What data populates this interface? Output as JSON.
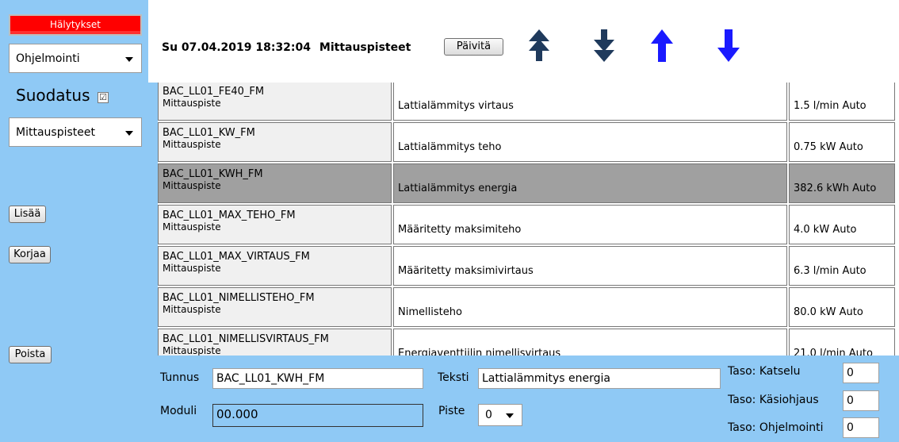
{
  "sidebar": {
    "alarms_label": "Hälytykset",
    "program_select": "Ohjelmointi",
    "filter_label": "Suodatus",
    "filter_checked": "☑",
    "category_select": "Mittauspisteet",
    "add_label": "Lisää",
    "edit_label": "Korjaa",
    "delete_label": "Poista"
  },
  "header": {
    "datetime": "Su 07.04.2019 18:32:04",
    "title": "Mittauspisteet",
    "update_label": "Päivitä",
    "arrows": [
      "arrow-top-icon",
      "arrow-bottom-icon",
      "arrow-up-icon",
      "arrow-down-icon"
    ]
  },
  "table": {
    "rows": [
      {
        "id": "BAC_LL01_FE40_FM",
        "type": "Mittauspiste",
        "text": "Lattialämmitys virtaus",
        "value": "1.5 l/min Auto"
      },
      {
        "id": "BAC_LL01_KW_FM",
        "type": "Mittauspiste",
        "text": "Lattialämmitys teho",
        "value": "0.75 kW Auto"
      },
      {
        "id": "BAC_LL01_KWH_FM",
        "type": "Mittauspiste",
        "text": "Lattialämmitys energia",
        "value": "382.6 kWh Auto"
      },
      {
        "id": "BAC_LL01_MAX_TEHO_FM",
        "type": "Mittauspiste",
        "text": "Määritetty maksimiteho",
        "value": "4.0 kW Auto"
      },
      {
        "id": "BAC_LL01_MAX_VIRTAUS_FM",
        "type": "Mittauspiste",
        "text": "Määritetty maksimivirtaus",
        "value": "6.3 l/min Auto"
      },
      {
        "id": "BAC_LL01_NIMELLISTEHO_FM",
        "type": "Mittauspiste",
        "text": "Nimellisteho",
        "value": "80.0 kW Auto"
      },
      {
        "id": "BAC_LL01_NIMELLISVIRTAUS_FM",
        "type": "Mittauspiste",
        "text": "Energiaventtiilin nimellisvirtaus",
        "value": "21.0 l/min Auto"
      }
    ]
  },
  "form": {
    "tunnus_label": "Tunnus",
    "tunnus_value": "BAC_LL01_KWH_FM",
    "teksti_label": "Teksti",
    "teksti_value": "Lattialämmitys energia",
    "moduli_label": "Moduli",
    "moduli_value": "00.000",
    "piste_label": "Piste",
    "piste_value": "0",
    "taso_katselu_label": "Taso: Katselu",
    "taso_katselu_value": "0",
    "taso_kasiohjaus_label": "Taso: Käsiohjaus",
    "taso_kasiohjaus_value": "0",
    "taso_ohjelmointi_label": "Taso: Ohjelmointi",
    "taso_ohjelmointi_value": "0"
  },
  "colors": {
    "accent": "#8fc9f5",
    "alarm": "#ff0000",
    "arrow_dark": "#1f3a5c",
    "arrow_blue": "#1a1aff",
    "selected_row": "#a0a0a0"
  }
}
